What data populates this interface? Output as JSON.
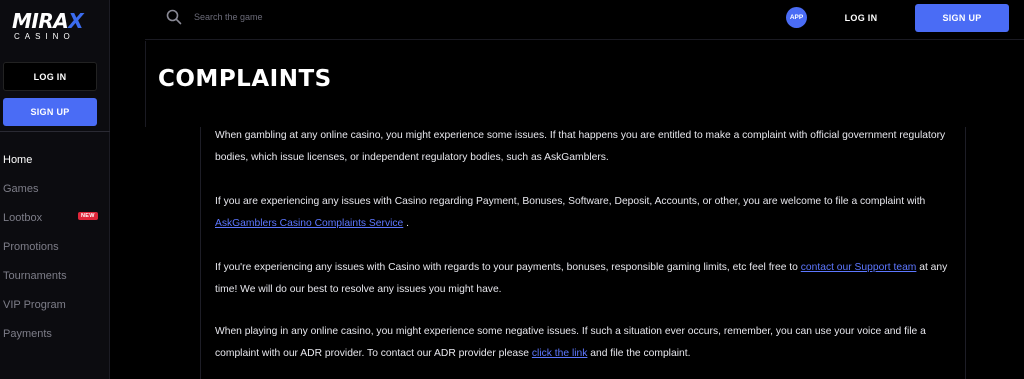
{
  "brand": {
    "name_pre": "MIRA",
    "name_x": "X",
    "sub": "CASINO"
  },
  "sidebar": {
    "login_label": "LOG IN",
    "signup_label": "SIGN UP",
    "items": [
      {
        "label": "Home",
        "active": true
      },
      {
        "label": "Games"
      },
      {
        "label": "Lootbox",
        "badge": "NEW"
      },
      {
        "label": "Promotions"
      },
      {
        "label": "Tournaments"
      },
      {
        "label": "VIP Program"
      },
      {
        "label": "Payments"
      }
    ]
  },
  "header": {
    "search_placeholder": "Search the game",
    "app_label": "APP",
    "login_label": "LOG IN",
    "signup_label": "SIGN UP"
  },
  "page": {
    "title": "COMPLAINTS",
    "p1": "When gambling at any online casino, you might experience some issues. If that happens you are entitled to make a complaint with official government regulatory bodies, which issue licenses, or independent regulatory bodies, such as AskGamblers.",
    "p2_text": "If you are experiencing any issues with Casino regarding Payment, Bonuses, Software, Deposit, Accounts, or other, you are welcome to file a complaint with ",
    "p2_link": "AskGamblers Casino Complaints Service",
    "p2_end": " .",
    "p3_text": "If you're experiencing any issues with Casino with regards to your payments, bonuses, responsible gaming limits, etc feel free to ",
    "p3_link": "contact our Support team",
    "p3_end": " at any time! We will do our best to resolve any issues you might have.",
    "p4_text": "When playing in any online casino, you might experience some negative issues. If such a situation ever occurs, remember, you can use your voice and file a complaint with our ADR provider. To contact our ADR provider please ",
    "p4_link": "click the link",
    "p4_end": " and file the complaint."
  },
  "colors": {
    "accent": "#4a6cf5",
    "link": "#5d77ff",
    "badge": "#e0263a"
  }
}
